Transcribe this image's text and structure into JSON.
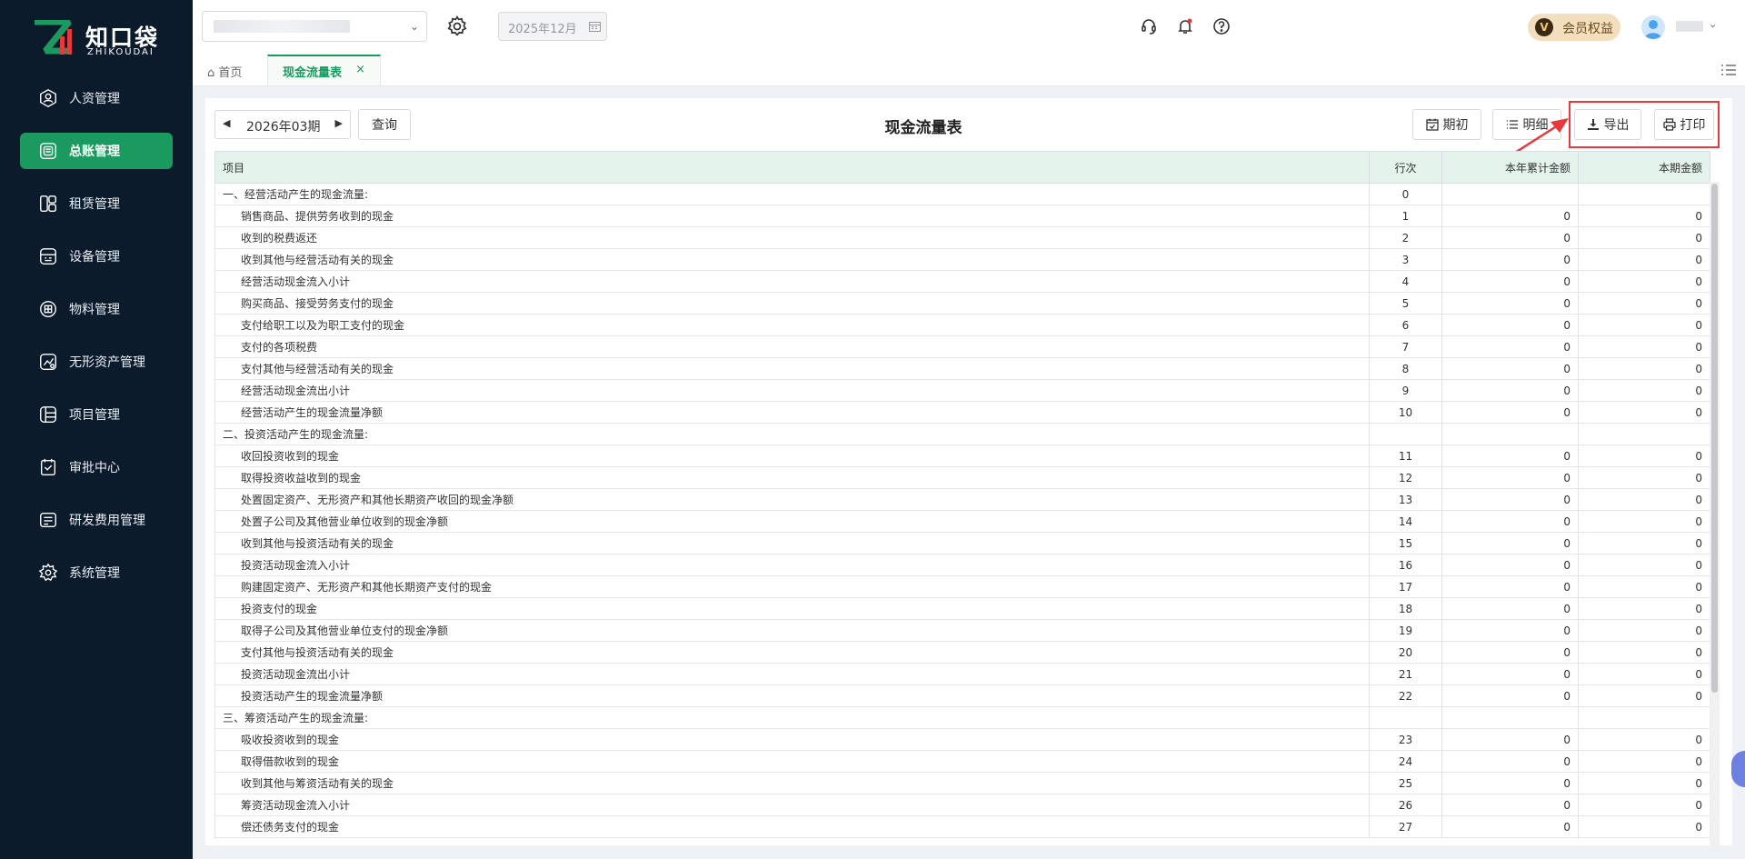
{
  "brand": {
    "name": "知口袋",
    "sub": "ZHIKOUDAI"
  },
  "sidebar": {
    "items": [
      {
        "label": "人资管理",
        "icon": "user-badge-icon",
        "active": false
      },
      {
        "label": "总账管理",
        "icon": "ledger-icon",
        "active": true
      },
      {
        "label": "租赁管理",
        "icon": "lease-icon",
        "active": false
      },
      {
        "label": "设备管理",
        "icon": "device-icon",
        "active": false
      },
      {
        "label": "物料管理",
        "icon": "material-icon",
        "active": false
      },
      {
        "label": "无形资产管理",
        "icon": "intangible-asset-icon",
        "active": false
      },
      {
        "label": "项目管理",
        "icon": "project-icon",
        "active": false
      },
      {
        "label": "审批中心",
        "icon": "approval-icon",
        "active": false
      },
      {
        "label": "研发费用管理",
        "icon": "rd-expense-icon",
        "active": false
      },
      {
        "label": "系统管理",
        "icon": "settings-icon",
        "active": false
      }
    ]
  },
  "header": {
    "date_value": "2025年12月",
    "vip_label": "会员权益",
    "vip_letter": "V"
  },
  "tabs": {
    "home": "首页",
    "active": "现金流量表",
    "close": "×"
  },
  "report": {
    "period": "2026年03期",
    "query_btn": "查询",
    "title": "现金流量表",
    "btn_opening": "期初",
    "btn_detail": "明细",
    "btn_export": "导出",
    "btn_print": "打印",
    "columns": [
      "项目",
      "行次",
      "本年累计金额",
      "本期金额"
    ],
    "rows": [
      {
        "name": "一、经营活动产生的现金流量:",
        "line": "0",
        "ytd": "",
        "period": "",
        "section": true
      },
      {
        "name": "销售商品、提供劳务收到的现金",
        "line": "1",
        "ytd": "0",
        "period": "0"
      },
      {
        "name": "收到的税费返还",
        "line": "2",
        "ytd": "0",
        "period": "0"
      },
      {
        "name": "收到其他与经营活动有关的现金",
        "line": "3",
        "ytd": "0",
        "period": "0"
      },
      {
        "name": "经营活动现金流入小计",
        "line": "4",
        "ytd": "0",
        "period": "0"
      },
      {
        "name": "购买商品、接受劳务支付的现金",
        "line": "5",
        "ytd": "0",
        "period": "0"
      },
      {
        "name": "支付给职工以及为职工支付的现金",
        "line": "6",
        "ytd": "0",
        "period": "0"
      },
      {
        "name": "支付的各项税费",
        "line": "7",
        "ytd": "0",
        "period": "0"
      },
      {
        "name": "支付其他与经营活动有关的现金",
        "line": "8",
        "ytd": "0",
        "period": "0"
      },
      {
        "name": "经营活动现金流出小计",
        "line": "9",
        "ytd": "0",
        "period": "0"
      },
      {
        "name": "经营活动产生的现金流量净额",
        "line": "10",
        "ytd": "0",
        "period": "0"
      },
      {
        "name": "二、投资活动产生的现金流量:",
        "line": "",
        "ytd": "",
        "period": "",
        "section": true
      },
      {
        "name": "收回投资收到的现金",
        "line": "11",
        "ytd": "0",
        "period": "0"
      },
      {
        "name": "取得投资收益收到的现金",
        "line": "12",
        "ytd": "0",
        "period": "0"
      },
      {
        "name": "处置固定资产、无形资产和其他长期资产收回的现金净额",
        "line": "13",
        "ytd": "0",
        "period": "0"
      },
      {
        "name": "处置子公司及其他营业单位收到的现金净额",
        "line": "14",
        "ytd": "0",
        "period": "0"
      },
      {
        "name": "收到其他与投资活动有关的现金",
        "line": "15",
        "ytd": "0",
        "period": "0"
      },
      {
        "name": "投资活动现金流入小计",
        "line": "16",
        "ytd": "0",
        "period": "0"
      },
      {
        "name": "购建固定资产、无形资产和其他长期资产支付的现金",
        "line": "17",
        "ytd": "0",
        "period": "0"
      },
      {
        "name": "投资支付的现金",
        "line": "18",
        "ytd": "0",
        "period": "0"
      },
      {
        "name": "取得子公司及其他营业单位支付的现金净额",
        "line": "19",
        "ytd": "0",
        "period": "0"
      },
      {
        "name": "支付其他与投资活动有关的现金",
        "line": "20",
        "ytd": "0",
        "period": "0"
      },
      {
        "name": "投资活动现金流出小计",
        "line": "21",
        "ytd": "0",
        "period": "0"
      },
      {
        "name": "投资活动产生的现金流量净额",
        "line": "22",
        "ytd": "0",
        "period": "0"
      },
      {
        "name": "三、筹资活动产生的现金流量:",
        "line": "",
        "ytd": "",
        "period": "",
        "section": true
      },
      {
        "name": "吸收投资收到的现金",
        "line": "23",
        "ytd": "0",
        "period": "0"
      },
      {
        "name": "取得借款收到的现金",
        "line": "24",
        "ytd": "0",
        "period": "0"
      },
      {
        "name": "收到其他与筹资活动有关的现金",
        "line": "25",
        "ytd": "0",
        "period": "0"
      },
      {
        "name": "筹资活动现金流入小计",
        "line": "26",
        "ytd": "0",
        "period": "0"
      },
      {
        "name": "偿还债务支付的现金",
        "line": "27",
        "ytd": "0",
        "period": "0"
      }
    ]
  },
  "colors": {
    "accent": "#1a9a5e",
    "sidebar_bg": "#0b1b2c",
    "header_row": "#e4f3ec",
    "highlight": "#e5393b"
  }
}
